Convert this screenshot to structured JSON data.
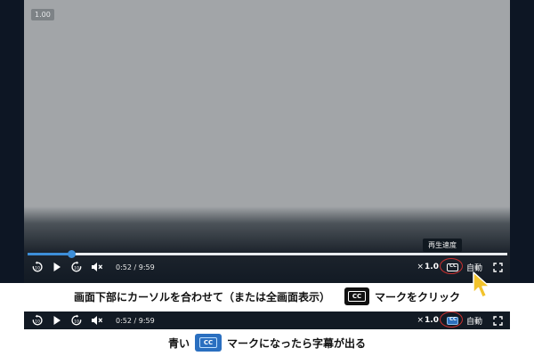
{
  "player": {
    "speed_badge": "1.00",
    "tooltip": "再生速度",
    "progress": 0.09,
    "time": "0:52 / 9:59",
    "speed_prefix": "×",
    "speed_value": "1.0",
    "cc_label": "CC",
    "auto_label": "自動"
  },
  "captions": {
    "step1_before": "画面下部にカーソルを合わせて（または全画面表示）",
    "step1_icon": "CC",
    "step1_after": "マークをクリック",
    "step2_before": "青い",
    "step2_icon": "CC",
    "step2_after": "マークになったら字幕が出る"
  },
  "colors": {
    "progress": "#3d8ed8",
    "highlight_ring": "#c8302f",
    "cc_active": "#2d6fbd",
    "cursor": "#f2c32c"
  },
  "icons": [
    "rewind-10-icon",
    "play-icon",
    "forward-10-icon",
    "mute-icon",
    "cc-icon",
    "fullscreen-icon",
    "cursor-icon"
  ]
}
